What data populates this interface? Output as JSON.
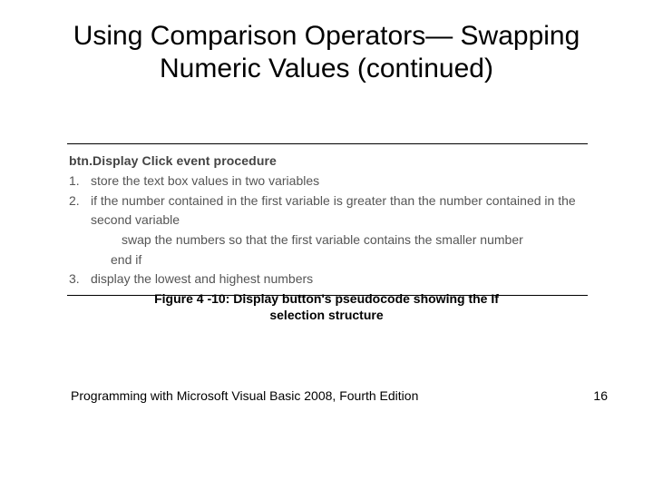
{
  "slide": {
    "title": "Using Comparison Operators— Swapping Numeric Values (continued)",
    "procedure_title": "btn.Display Click event procedure",
    "steps": {
      "one_num": "1.",
      "one_text": "store the text box values in two variables",
      "two_num": "2.",
      "two_text": "if the number contained in the first variable is greater than the number contained in the second variable",
      "two_sub": "swap the numbers so that the first variable contains the smaller number",
      "two_endif": "end if",
      "three_num": "3.",
      "three_text": "display the lowest and highest numbers"
    },
    "caption": "Figure 4 -10: Display button's pseudocode showing the If selection structure",
    "footer_left": "Programming with Microsoft Visual Basic 2008, Fourth Edition",
    "page_number": "16"
  }
}
